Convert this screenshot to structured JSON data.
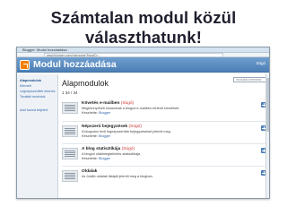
{
  "slide": {
    "title": "Számtalan modul közül választhatunk!"
  },
  "browser": {
    "title_text": "Blogger: Modul hozzáadása",
    "url": "www.blogger.com/rearrange?blogID=..."
  },
  "app": {
    "title": "Modul hozzáadása",
    "header_link": "Súgó"
  },
  "sidebar": {
    "items": [
      {
        "label": "Alapmodulok",
        "active": true
      },
      {
        "label": "Kiemelt",
        "active": false
      },
      {
        "label": "Legnépszerűbb elemek",
        "active": false
      },
      {
        "label": "További modulok",
        "active": false
      }
    ],
    "add_label": "Add hozzá teljeled"
  },
  "main": {
    "section_title": "Alapmodulok",
    "pager": "1 34 / 34",
    "search_placeholder": "modulok keresése",
    "modules": [
      {
        "name": "Követés e-mailben",
        "help": "(Súgó)",
        "description": "Megkönnyítheti olvasóinak a blogod e-mailben történő követését.",
        "author_prefix": "Készítette:",
        "author": "Blogger"
      },
      {
        "name": "Népszerű bejegyzések",
        "help": "(Súgó)",
        "description": "A blogodon lévő legnépszerűbb bejegyzéseket jeleníti meg.",
        "author_prefix": "Készítette:",
        "author": "Blogger"
      },
      {
        "name": "A blog statisztikája",
        "help": "(Súgó)",
        "description": "A blogod oldalmegtekintés statisztikája.",
        "author_prefix": "Készítette:",
        "author": "Blogger"
      },
      {
        "name": "Oldalak",
        "help": "",
        "description": "Az önálló oldalak listáját jeleníti meg a blogban.",
        "author_prefix": "",
        "author": ""
      }
    ]
  },
  "colors": {
    "header": "#4d7fb6",
    "logo": "#f57d00",
    "link": "#3366aa",
    "help": "#cc3333"
  }
}
